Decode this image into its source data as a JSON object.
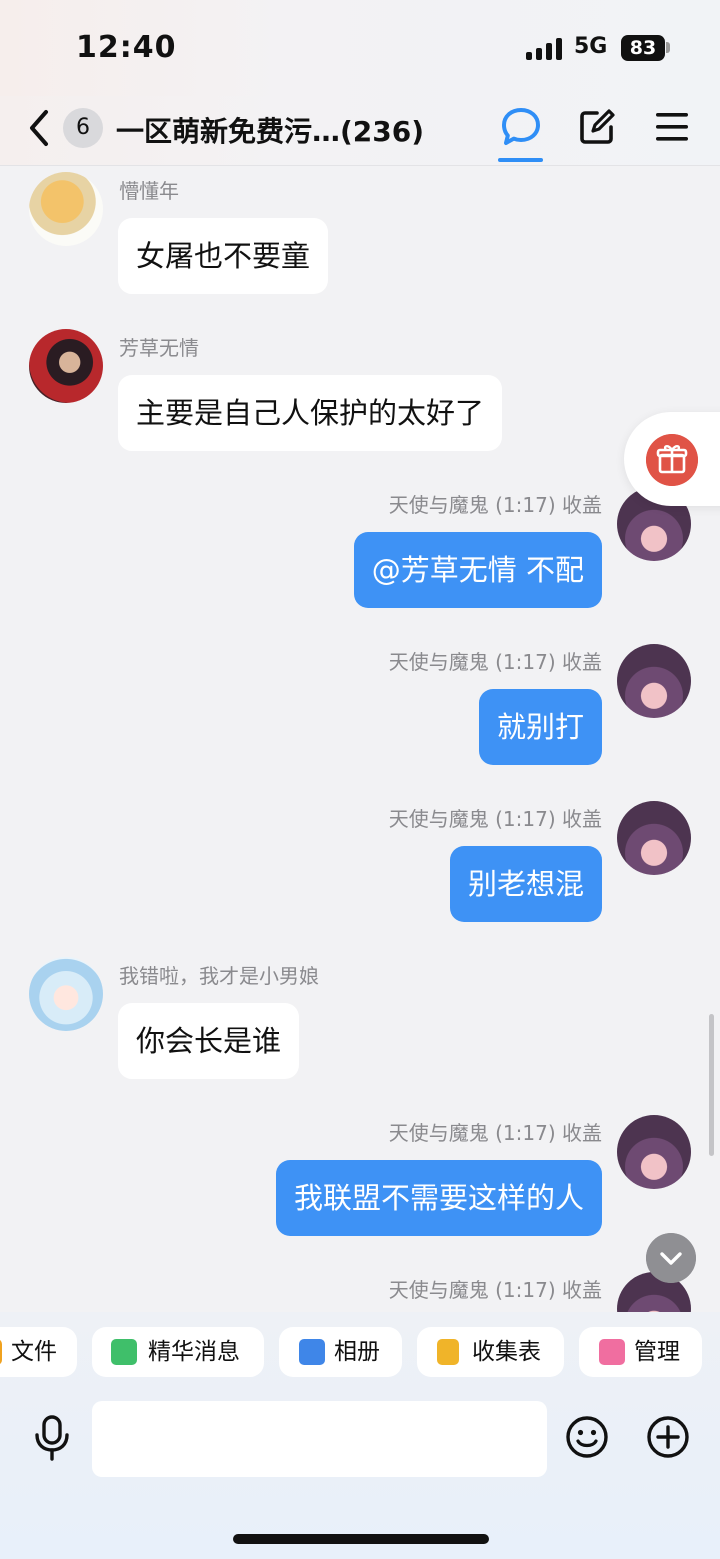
{
  "status_bar": {
    "time": "12:40",
    "network": "5G",
    "battery": "83"
  },
  "nav": {
    "unread_count": "6",
    "title": "一区萌新免费污…(236)"
  },
  "messages": [
    {
      "sender": "懵懂年",
      "text": "女屠也不要童",
      "direction": "in"
    },
    {
      "sender": "芳草无情",
      "text": "主要是自己人保护的太好了",
      "direction": "in"
    },
    {
      "sender": "天使与魔鬼 (1:17) 收盖",
      "text": "@芳草无情 不配",
      "direction": "out"
    },
    {
      "sender": "天使与魔鬼 (1:17) 收盖",
      "text": "就别打",
      "direction": "out"
    },
    {
      "sender": "天使与魔鬼 (1:17) 收盖",
      "text": "别老想混",
      "direction": "out"
    },
    {
      "sender": "我错啦，我才是小男娘",
      "text": "你会长是谁",
      "direction": "in"
    },
    {
      "sender": "天使与魔鬼 (1:17) 收盖",
      "text": "我联盟不需要这样的人",
      "direction": "out"
    },
    {
      "sender": "天使与魔鬼 (1:17) 收盖",
      "text": "",
      "direction": "out"
    }
  ],
  "quick_actions": [
    {
      "label": "文件",
      "icon": "file-icon",
      "color": "#f0a21f"
    },
    {
      "label": "精华消息",
      "icon": "essence-icon",
      "color": "#3fbf6a"
    },
    {
      "label": "相册",
      "icon": "album-icon",
      "color": "#3f86e8"
    },
    {
      "label": "收集表",
      "icon": "form-icon",
      "color": "#f0b429"
    },
    {
      "label": "管理",
      "icon": "manage-icon",
      "color": "#f06ea0"
    }
  ],
  "input": {
    "placeholder": ""
  },
  "colors": {
    "accent": "#3e92f5",
    "gift": "#e05346"
  }
}
